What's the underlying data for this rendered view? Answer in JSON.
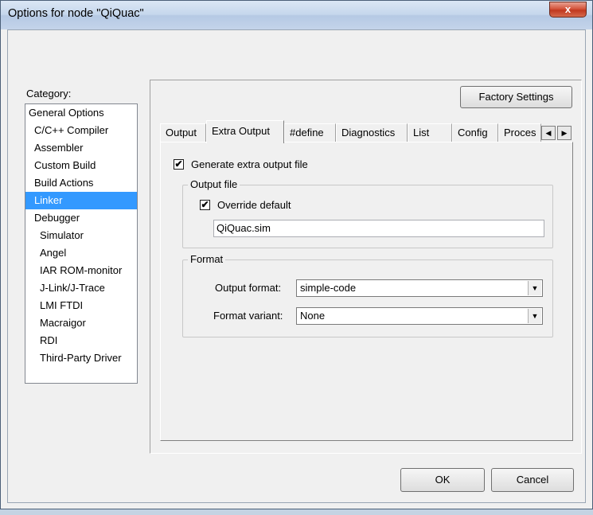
{
  "window": {
    "title": "Options for node \"QiQuac\"",
    "close_glyph": "x"
  },
  "category": {
    "label": "Category:",
    "items": [
      {
        "label": "General Options"
      },
      {
        "label": "C/C++ Compiler"
      },
      {
        "label": "Assembler"
      },
      {
        "label": "Custom Build"
      },
      {
        "label": "Build Actions"
      },
      {
        "label": "Linker"
      },
      {
        "label": "Debugger"
      },
      {
        "label": "Simulator"
      },
      {
        "label": "Angel"
      },
      {
        "label": "IAR ROM-monitor"
      },
      {
        "label": "J-Link/J-Trace"
      },
      {
        "label": "LMI FTDI"
      },
      {
        "label": "Macraigor"
      },
      {
        "label": "RDI"
      },
      {
        "label": "Third-Party Driver"
      }
    ],
    "selected": "Linker"
  },
  "factory_settings_label": "Factory Settings",
  "tabs": [
    {
      "label": "Output"
    },
    {
      "label": "Extra Output"
    },
    {
      "label": "#define"
    },
    {
      "label": "Diagnostics"
    },
    {
      "label": "List"
    },
    {
      "label": "Config"
    },
    {
      "label": "Proces"
    }
  ],
  "active_tab": "Extra Output",
  "extra_output": {
    "generate_label": "Generate extra output file",
    "generate_checked": true,
    "output_file_group": "Output file",
    "override_label": "Override default",
    "override_checked": true,
    "output_file_value": "QiQuac.sim",
    "format_group": "Format",
    "output_format_label": "Output format:",
    "output_format_value": "simple-code",
    "format_variant_label": "Format variant:",
    "format_variant_value": "None"
  },
  "buttons": {
    "ok": "OK",
    "cancel": "Cancel"
  },
  "glyphs": {
    "check": "✔",
    "dropdown": "▼",
    "scroll_left": "◀",
    "scroll_right": "▶"
  },
  "colors": {
    "selection": "#3399ff",
    "dialog_bg": "#f0f0f0",
    "close_red": "#c7452e"
  }
}
